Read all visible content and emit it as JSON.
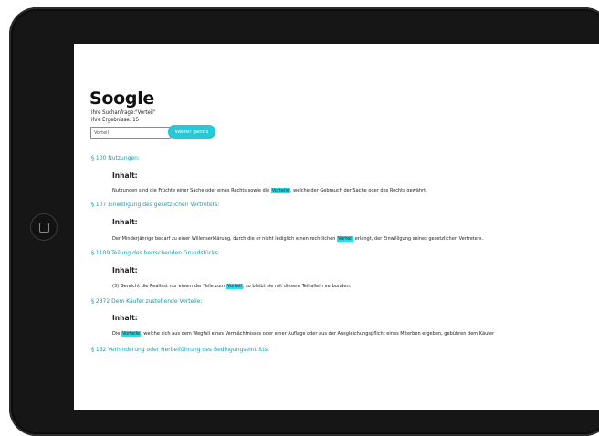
{
  "app": {
    "brand": "Soogle"
  },
  "search": {
    "query_line": "Ihre Suchanfrage:\"Vorteil\"",
    "count_line": "Ihre Ergebnisse: 15",
    "input_value": "Vorteil",
    "button_label": "Weiter geht's"
  },
  "results": {
    "content_heading": "Inhalt:",
    "items": [
      {
        "title": "§ 100 Nutzungen:",
        "snippet_before": "Nutzungen sind die Früchte einer Sache oder eines Rechts sowie die ",
        "highlight": "Vorteile",
        "snippet_after": ", welche der Gebrauch der Sache oder des Rechts gewährt."
      },
      {
        "title": "§ 107 Einwilligung des gesetzlichen Vertreters:",
        "snippet_before": "Der Minderjährige bedarf zu einer Willenserklärung, durch die er nicht lediglich einen rechtlichen ",
        "highlight": "Vorteil",
        "snippet_after": " erlangt, der Einwilligung seines gesetzlichen Vertreters."
      },
      {
        "title": "§ 1109 Teilung des herrschenden Grundstücks:",
        "snippet_before": "(3) Gereicht die Reallast nur einem der Teile zum ",
        "highlight": "Vorteil",
        "snippet_after": ", so bleibt sie mit diesem Teil allein verbunden."
      },
      {
        "title": "§ 2372 Dem Käufer zustehende Vorteile:",
        "snippet_before": "Die ",
        "highlight": "Vorteile",
        "snippet_after": ", welche sich aus dem Wegfall eines Vermächtnisses oder einer Auflage oder aus der Ausgleichungspflicht eines Miterben ergeben, gebühren dem Käufer"
      },
      {
        "title": "§ 162 Verhinderung oder Herbeiführung des Bedingungseintritts:"
      }
    ]
  },
  "colors": {
    "accent": "#28c8d6",
    "link": "#1a9aa8",
    "highlight": "#1de2ef",
    "bezel": "#161616"
  }
}
